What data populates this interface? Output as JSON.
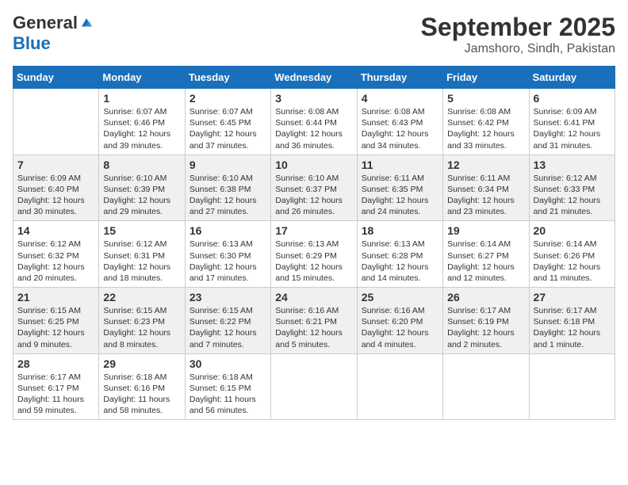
{
  "logo": {
    "general": "General",
    "blue": "Blue"
  },
  "header": {
    "month": "September 2025",
    "location": "Jamshoro, Sindh, Pakistan"
  },
  "weekdays": [
    "Sunday",
    "Monday",
    "Tuesday",
    "Wednesday",
    "Thursday",
    "Friday",
    "Saturday"
  ],
  "weeks": [
    [
      {
        "day": "",
        "info": ""
      },
      {
        "day": "1",
        "info": "Sunrise: 6:07 AM\nSunset: 6:46 PM\nDaylight: 12 hours\nand 39 minutes."
      },
      {
        "day": "2",
        "info": "Sunrise: 6:07 AM\nSunset: 6:45 PM\nDaylight: 12 hours\nand 37 minutes."
      },
      {
        "day": "3",
        "info": "Sunrise: 6:08 AM\nSunset: 6:44 PM\nDaylight: 12 hours\nand 36 minutes."
      },
      {
        "day": "4",
        "info": "Sunrise: 6:08 AM\nSunset: 6:43 PM\nDaylight: 12 hours\nand 34 minutes."
      },
      {
        "day": "5",
        "info": "Sunrise: 6:08 AM\nSunset: 6:42 PM\nDaylight: 12 hours\nand 33 minutes."
      },
      {
        "day": "6",
        "info": "Sunrise: 6:09 AM\nSunset: 6:41 PM\nDaylight: 12 hours\nand 31 minutes."
      }
    ],
    [
      {
        "day": "7",
        "info": "Sunrise: 6:09 AM\nSunset: 6:40 PM\nDaylight: 12 hours\nand 30 minutes."
      },
      {
        "day": "8",
        "info": "Sunrise: 6:10 AM\nSunset: 6:39 PM\nDaylight: 12 hours\nand 29 minutes."
      },
      {
        "day": "9",
        "info": "Sunrise: 6:10 AM\nSunset: 6:38 PM\nDaylight: 12 hours\nand 27 minutes."
      },
      {
        "day": "10",
        "info": "Sunrise: 6:10 AM\nSunset: 6:37 PM\nDaylight: 12 hours\nand 26 minutes."
      },
      {
        "day": "11",
        "info": "Sunrise: 6:11 AM\nSunset: 6:35 PM\nDaylight: 12 hours\nand 24 minutes."
      },
      {
        "day": "12",
        "info": "Sunrise: 6:11 AM\nSunset: 6:34 PM\nDaylight: 12 hours\nand 23 minutes."
      },
      {
        "day": "13",
        "info": "Sunrise: 6:12 AM\nSunset: 6:33 PM\nDaylight: 12 hours\nand 21 minutes."
      }
    ],
    [
      {
        "day": "14",
        "info": "Sunrise: 6:12 AM\nSunset: 6:32 PM\nDaylight: 12 hours\nand 20 minutes."
      },
      {
        "day": "15",
        "info": "Sunrise: 6:12 AM\nSunset: 6:31 PM\nDaylight: 12 hours\nand 18 minutes."
      },
      {
        "day": "16",
        "info": "Sunrise: 6:13 AM\nSunset: 6:30 PM\nDaylight: 12 hours\nand 17 minutes."
      },
      {
        "day": "17",
        "info": "Sunrise: 6:13 AM\nSunset: 6:29 PM\nDaylight: 12 hours\nand 15 minutes."
      },
      {
        "day": "18",
        "info": "Sunrise: 6:13 AM\nSunset: 6:28 PM\nDaylight: 12 hours\nand 14 minutes."
      },
      {
        "day": "19",
        "info": "Sunrise: 6:14 AM\nSunset: 6:27 PM\nDaylight: 12 hours\nand 12 minutes."
      },
      {
        "day": "20",
        "info": "Sunrise: 6:14 AM\nSunset: 6:26 PM\nDaylight: 12 hours\nand 11 minutes."
      }
    ],
    [
      {
        "day": "21",
        "info": "Sunrise: 6:15 AM\nSunset: 6:25 PM\nDaylight: 12 hours\nand 9 minutes."
      },
      {
        "day": "22",
        "info": "Sunrise: 6:15 AM\nSunset: 6:23 PM\nDaylight: 12 hours\nand 8 minutes."
      },
      {
        "day": "23",
        "info": "Sunrise: 6:15 AM\nSunset: 6:22 PM\nDaylight: 12 hours\nand 7 minutes."
      },
      {
        "day": "24",
        "info": "Sunrise: 6:16 AM\nSunset: 6:21 PM\nDaylight: 12 hours\nand 5 minutes."
      },
      {
        "day": "25",
        "info": "Sunrise: 6:16 AM\nSunset: 6:20 PM\nDaylight: 12 hours\nand 4 minutes."
      },
      {
        "day": "26",
        "info": "Sunrise: 6:17 AM\nSunset: 6:19 PM\nDaylight: 12 hours\nand 2 minutes."
      },
      {
        "day": "27",
        "info": "Sunrise: 6:17 AM\nSunset: 6:18 PM\nDaylight: 12 hours\nand 1 minute."
      }
    ],
    [
      {
        "day": "28",
        "info": "Sunrise: 6:17 AM\nSunset: 6:17 PM\nDaylight: 11 hours\nand 59 minutes."
      },
      {
        "day": "29",
        "info": "Sunrise: 6:18 AM\nSunset: 6:16 PM\nDaylight: 11 hours\nand 58 minutes."
      },
      {
        "day": "30",
        "info": "Sunrise: 6:18 AM\nSunset: 6:15 PM\nDaylight: 11 hours\nand 56 minutes."
      },
      {
        "day": "",
        "info": ""
      },
      {
        "day": "",
        "info": ""
      },
      {
        "day": "",
        "info": ""
      },
      {
        "day": "",
        "info": ""
      }
    ]
  ]
}
